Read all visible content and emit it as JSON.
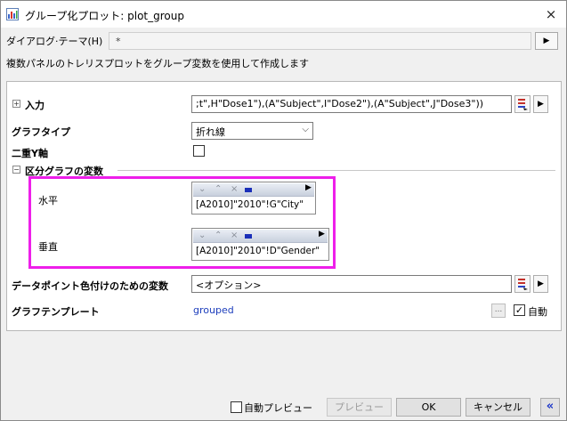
{
  "window": {
    "title": "グループ化プロット: plot_group",
    "close_icon": "×"
  },
  "theme": {
    "label": "ダイアログ·テーマ(H)",
    "value": "*",
    "arrow_icon": "▶"
  },
  "description": "複数パネルのトレリスプロットをグループ変数を使用して作成します",
  "input": {
    "expander": "⊞",
    "label": "入力",
    "value": ";t\",H\"Dose1\"),(A\"Subject\",I\"Dose2\"),(A\"Subject\",J\"Dose3\"))",
    "arrow_icon": "▶"
  },
  "graph_type": {
    "label": "グラフタイプ",
    "value": "折れ線",
    "chevron_icon": "⌵"
  },
  "double_y": {
    "label": "二重Y軸",
    "checked_glyph": ""
  },
  "group_section": {
    "expander": "⊟",
    "label": "区分グラフの変数"
  },
  "horizontal": {
    "label": "水平",
    "value": "[A2010]\"2010\"!G\"City\""
  },
  "vertical": {
    "label": "垂直",
    "value": "[A2010]\"2010\"!D\"Gender\""
  },
  "var_toolbar_icons": {
    "down": "⌄",
    "up": "⌃",
    "remove": "×",
    "play": "▶"
  },
  "color_var": {
    "label": "データポイント色付けのための変数",
    "value": "<オプション>",
    "arrow_icon": "▶"
  },
  "template": {
    "label": "グラフテンプレート",
    "value": "grouped",
    "ellipsis": "...",
    "auto_label": "自動",
    "auto_checked_glyph": "✓"
  },
  "footer": {
    "auto_preview_label": "自動プレビュー",
    "preview_label": "プレビュー",
    "ok_label": "OK",
    "cancel_label": "キャンセル",
    "collapse_icon": "«"
  },
  "colors": {
    "highlight": "#ee1fea",
    "link": "#1d3ebc"
  }
}
